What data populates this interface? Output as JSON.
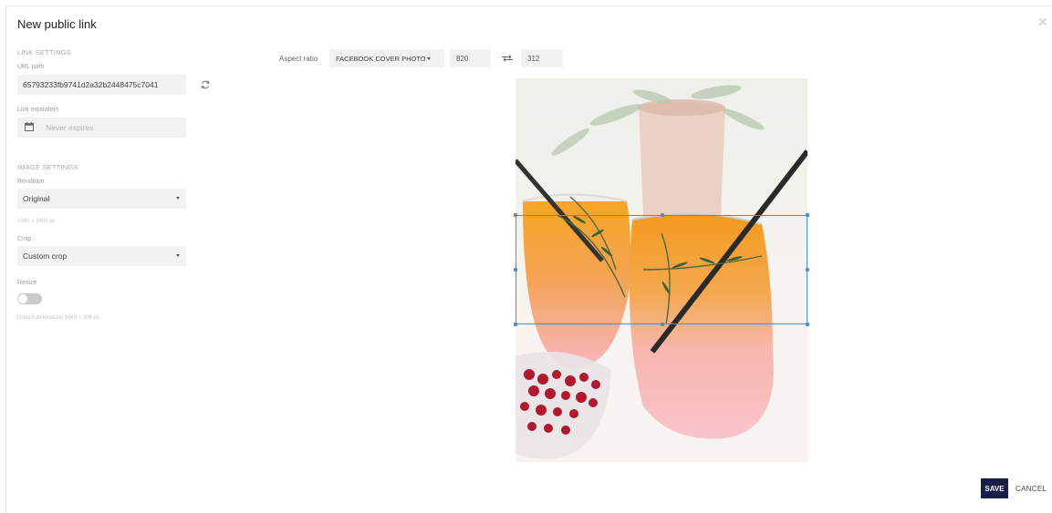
{
  "dialog": {
    "title": "New public link",
    "close_icon": "close-icon"
  },
  "link_settings": {
    "section_title": "LINK SETTINGS",
    "url_path_label": "URL path",
    "url_path_value": "65793233fb9741d2a32b2448475c7041",
    "regenerate_icon": "refresh-icon",
    "expiration_label": "Link expiration",
    "expiration_placeholder": "Never expires",
    "calendar_icon": "calendar-icon"
  },
  "image_settings": {
    "section_title": "IMAGE SETTINGS",
    "rendition_label": "Rendition",
    "rendition_value": "Original",
    "rendition_dimensions": "1040 × 1400 px",
    "crop_label": "Crop",
    "crop_value": "Custom crop",
    "resize_label": "Resize",
    "resize_enabled": false,
    "output_dimensions": "Output dimensions 1040 × 396 px"
  },
  "toolbar": {
    "aspect_label": "Aspect ratio",
    "aspect_value": "FACEBOOK COVER PHOTO",
    "width": "820",
    "height": "312",
    "swap_icon": "swap-icon"
  },
  "footer": {
    "save_label": "SAVE",
    "cancel_label": "CANCEL"
  },
  "colors": {
    "accent": "#1a1f4a",
    "crop_border": "#4a90d9",
    "field_bg": "#f2f2f2"
  }
}
